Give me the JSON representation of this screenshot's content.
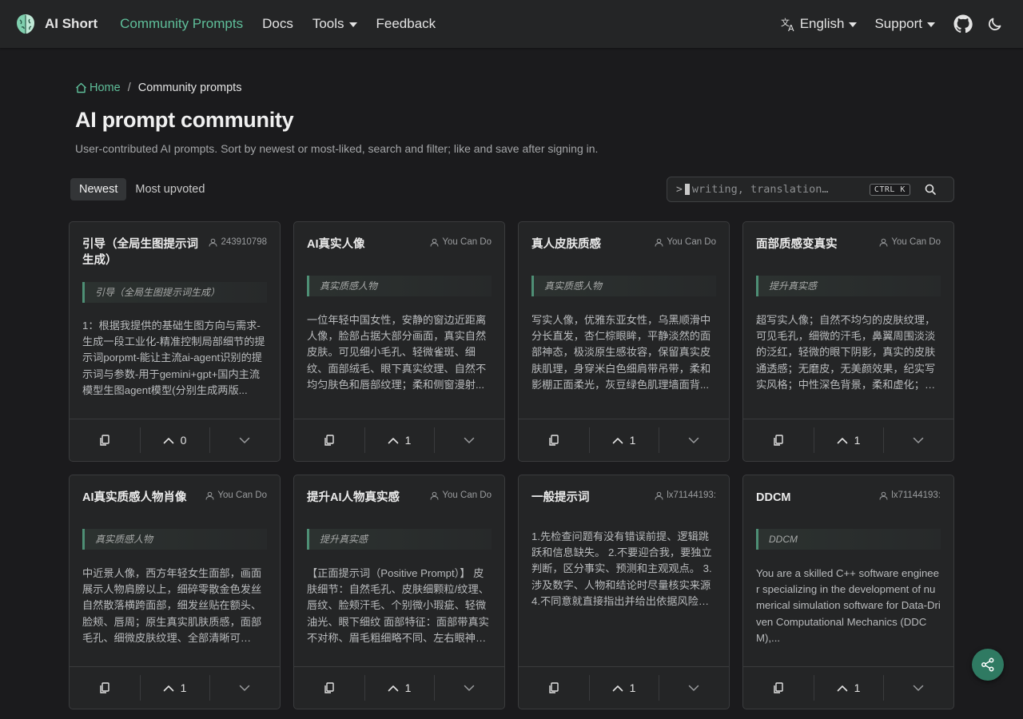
{
  "nav": {
    "brand": "AI Short",
    "links": [
      "Community Prompts",
      "Docs",
      "Tools",
      "Feedback"
    ],
    "language": "English",
    "support": "Support"
  },
  "breadcrumb": {
    "home": "Home",
    "current": "Community prompts"
  },
  "page": {
    "title": "AI prompt community",
    "subtitle": "User-contributed AI prompts. Sort by newest or most-liked, search and filter; like and save after signing in."
  },
  "sort": {
    "newest": "Newest",
    "most_upvoted": "Most upvoted"
  },
  "search": {
    "prompt": ">",
    "placeholder": "writing, translation…",
    "shortcut": "CTRL K"
  },
  "colors": {
    "accent": "#5fbf9a",
    "background": "#1b1b1d",
    "card": "#242526",
    "fab": "#2f7a62"
  },
  "cards": [
    {
      "title": "引导（全局生图提示词生成）",
      "author": "243910798",
      "tag": "引导（全局生图提示词生成）",
      "body": "1：根据我提供的基础生图方向与需求-生成一段工业化-精准控制局部细节的提示词porpmt-能让主流ai-agent识别的提示词与参数-用于gemini+gpt+国内主流模型生图agent模型(分别生成两版...",
      "votes": "0"
    },
    {
      "title": "AI真实人像",
      "author": "You Can Do",
      "tag": "真实质感人物",
      "body": "一位年轻中国女性，安静的窗边近距离人像，脸部占据大部分画面，真实自然皮肤。可见细小毛孔、轻微雀斑、细纹、面部绒毛、眼下真实纹理、自然不均匀肤色和唇部纹理；柔和侧窗漫射...",
      "votes": "1"
    },
    {
      "title": "真人皮肤质感",
      "author": "You Can Do",
      "tag": "真实质感人物",
      "body": "写实人像，优雅东亚女性，乌黑顺滑中分长直发，杏仁棕眼眸，平静淡然的面部神态，极淡原生感妆容，保留真实皮肤肌理，身穿米白色细肩带吊带，柔和影棚正面柔光，灰豆绿色肌理墙面背...",
      "votes": "1"
    },
    {
      "title": "面部质感变真实",
      "author": "You Can Do",
      "tag": "提升真实感",
      "body": "超写实人像；自然不均匀的皮肤纹理，可见毛孔，细微的汗毛，鼻翼周围淡淡的泛红，轻微的眼下阴影，真实的皮肤通透感；无磨皮，无美颜效果，纪实写实风格；中性深色背景，柔和虚化；侧...",
      "votes": "1"
    },
    {
      "title": "AI真实质感人物肖像",
      "author": "You Can Do",
      "tag": "真实质感人物",
      "body": "中近景人像，西方年轻女生面部，画面展示人物肩膀以上，细碎零散金色发丝自然散落横跨面部，细发丝贴在额头、脸颊、唇周；原生真实肌肤质感，面部毛孔、细微皮肤纹理、全部清晰可见，...",
      "votes": "1"
    },
    {
      "title": "提升AI人物真实感",
      "author": "You Can Do",
      "tag": "提升真实感",
      "body": "【正面提示词（Positive Prompt）】 皮肤细节：自然毛孔、皮肤细颗粒/纹理、唇纹、脸颊汗毛、个别微小瑕疵、轻微油光、眼下细纹 面部特征：面部带真实不对称、眉毛粗细略不同、左右眼神态...",
      "votes": "1"
    },
    {
      "title": "一般提示词",
      "author": "lx71144193:",
      "tag": "",
      "body": "1.先检查问题有没有错误前提、逻辑跳跃和信息缺失。 2.不要迎合我，要独立判断，区分事实、预测和主观观点。 3.涉及数字、人物和结论时尽量核实来源 4.不同意就直接指出并给出依据风险和替...",
      "votes": "1"
    },
    {
      "title": "DDCM",
      "author": "lx71144193:",
      "tag": "DDCM",
      "body": "You are a skilled C++ software engineer specializing in the development of numerical simulation software for Data-Driven Computational Mechanics (DDCM),...",
      "votes": "1"
    }
  ]
}
